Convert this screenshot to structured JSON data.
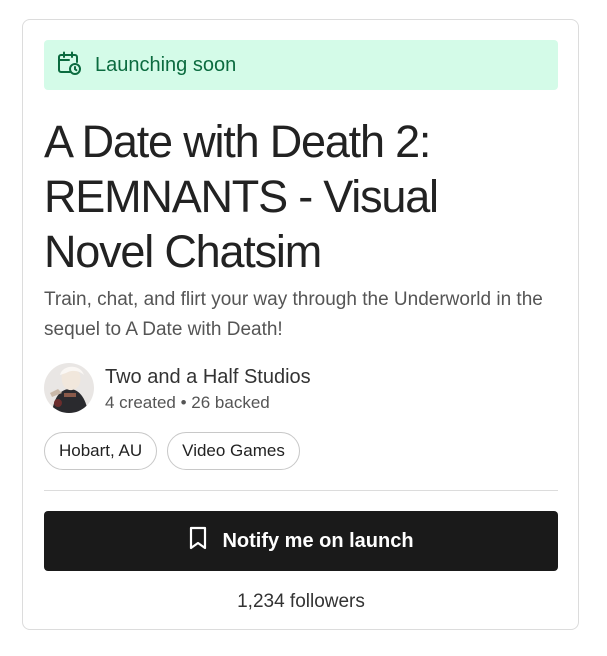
{
  "banner": {
    "icon": "calendar-clock-icon",
    "text": "Launching soon",
    "bg": "#d4fbe8",
    "color": "#0b6b3f"
  },
  "project": {
    "title": "A Date with Death 2: REMNANTS - Visual Novel Chatsim",
    "subtitle": "Train, chat, and flirt your way through the Underworld in the sequel to A Date with Death!"
  },
  "creator": {
    "name": "Two and a Half Studios",
    "stats": "4 created • 26 backed"
  },
  "tags": [
    {
      "label": "Hobart, AU"
    },
    {
      "label": "Video Games"
    }
  ],
  "notify_button": {
    "icon": "bookmark-icon",
    "label": "Notify me on launch"
  },
  "followers": "1,234 followers"
}
